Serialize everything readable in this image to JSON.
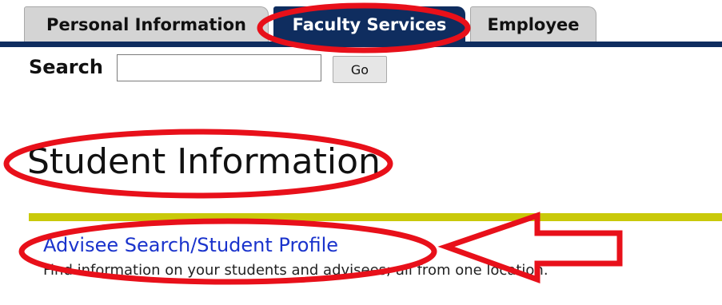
{
  "tabs": [
    {
      "label": "Personal Information",
      "active": false
    },
    {
      "label": "Faculty Services",
      "active": true
    },
    {
      "label": "Employee",
      "active": false
    }
  ],
  "search": {
    "label": "Search",
    "value": "",
    "placeholder": "",
    "button_label": "Go"
  },
  "page": {
    "title": "Student Information"
  },
  "menu": {
    "items": [
      {
        "title": "Advisee Search/Student Profile",
        "description": "Find information on your students and advisees; all from one location."
      }
    ]
  },
  "annotations": {
    "color": "#e8101a",
    "shapes": [
      "ellipse-around-faculty-services-tab",
      "ellipse-around-page-title",
      "ellipse-around-advisee-link",
      "arrow-pointing-left"
    ]
  },
  "colors": {
    "tab_active": "#0f2d5f",
    "divider": "#c9c90a",
    "link": "#1a33cc"
  }
}
